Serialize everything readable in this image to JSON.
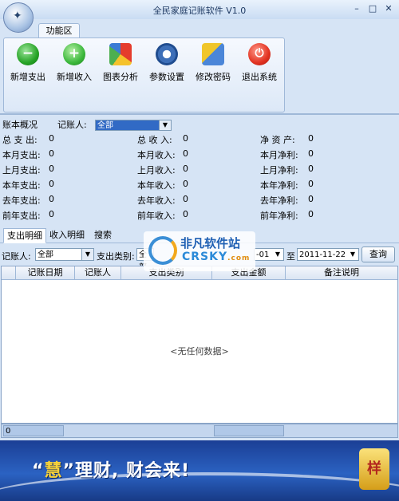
{
  "window": {
    "title": "全民家庭记账软件 V1.0",
    "min": "–",
    "max": "□",
    "close": "✕",
    "orb_glyph": "✦"
  },
  "ribbon": {
    "tab": "功能区",
    "tools": [
      {
        "label": "新增支出",
        "icon": "minus-circle-icon",
        "glyph": "−"
      },
      {
        "label": "新增收入",
        "icon": "plus-circle-icon",
        "glyph": "+"
      },
      {
        "label": "图表分析",
        "icon": "chart-icon",
        "glyph": ""
      },
      {
        "label": "参数设置",
        "icon": "gear-icon",
        "glyph": ""
      },
      {
        "label": "修改密码",
        "icon": "key-icon",
        "glyph": ""
      },
      {
        "label": "退出系统",
        "icon": "power-icon",
        "glyph": "⏻"
      }
    ]
  },
  "summary": {
    "title": "账本概况",
    "bookkeeper_label": "记账人:",
    "bookkeeper_value": "全部",
    "col1": [
      {
        "label": "总 支 出:",
        "value": "0"
      },
      {
        "label": "本月支出:",
        "value": "0"
      },
      {
        "label": "上月支出:",
        "value": "0"
      },
      {
        "label": "本年支出:",
        "value": "0"
      },
      {
        "label": "去年支出:",
        "value": "0"
      },
      {
        "label": "前年支出:",
        "value": "0"
      }
    ],
    "col2": [
      {
        "label": "总 收 入:",
        "value": "0"
      },
      {
        "label": "本月收入:",
        "value": "0"
      },
      {
        "label": "上月收入:",
        "value": "0"
      },
      {
        "label": "本年收入:",
        "value": "0"
      },
      {
        "label": "去年收入:",
        "value": "0"
      },
      {
        "label": "前年收入:",
        "value": "0"
      }
    ],
    "col3": [
      {
        "label": "净 资 产:",
        "value": "0"
      },
      {
        "label": "本月净利:",
        "value": "0"
      },
      {
        "label": "上月净利:",
        "value": "0"
      },
      {
        "label": "本年净利:",
        "value": "0"
      },
      {
        "label": "去年净利:",
        "value": "0"
      },
      {
        "label": "前年净利:",
        "value": "0"
      }
    ]
  },
  "detail_tabs": [
    "支出明细",
    "收入明细",
    "搜索"
  ],
  "filter": {
    "bookkeeper_label": "记账人:",
    "bookkeeper_value": "全部",
    "type_label": "支出类别:",
    "type_value": "全部",
    "date_from": "-01",
    "to_label": "至",
    "date_to": "2011-11-22",
    "query_button": "查询"
  },
  "table": {
    "columns": [
      "记账日期",
      "记账人",
      "支出类别",
      "支出金额",
      "备注说明"
    ],
    "empty_text": "<无任何数据>"
  },
  "status": {
    "left_value": "0",
    "right_value": ""
  },
  "banner": {
    "quote_open": "“",
    "highlight": "慧",
    "quote_close": "”",
    "rest": "理财, 财会来!",
    "badge": "样"
  },
  "watermark": {
    "cn": "非凡软件站",
    "en": "CRSKY",
    "suffix": ".com"
  }
}
